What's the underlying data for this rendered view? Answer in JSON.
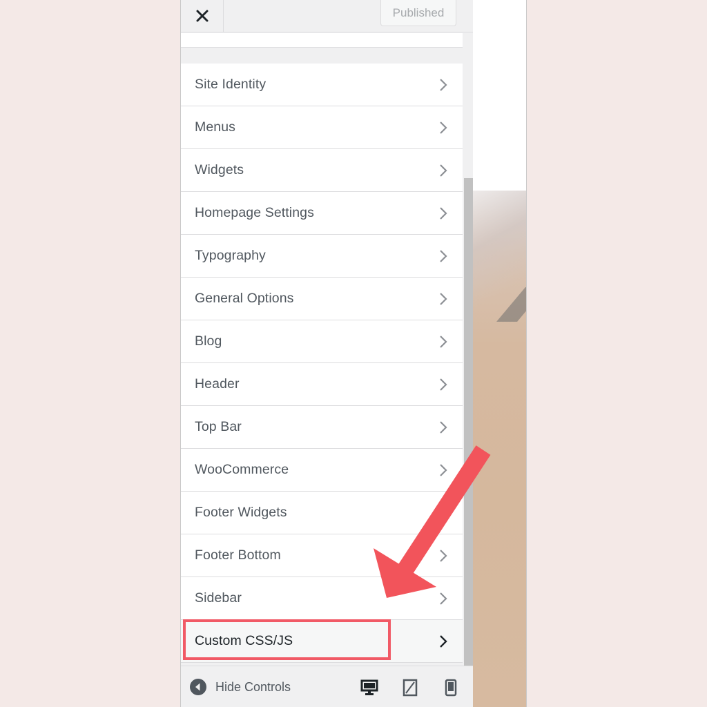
{
  "header": {
    "close_label": "Close",
    "publish_label": "Published"
  },
  "menu": {
    "items": [
      {
        "label": "Site Identity"
      },
      {
        "label": "Menus"
      },
      {
        "label": "Widgets"
      },
      {
        "label": "Homepage Settings"
      },
      {
        "label": "Typography"
      },
      {
        "label": "General Options"
      },
      {
        "label": "Blog"
      },
      {
        "label": "Header"
      },
      {
        "label": "Top Bar"
      },
      {
        "label": "WooCommerce"
      },
      {
        "label": "Footer Widgets"
      },
      {
        "label": "Footer Bottom"
      },
      {
        "label": "Sidebar"
      },
      {
        "label": "Custom CSS/JS"
      }
    ]
  },
  "footer": {
    "hide_controls_label": "Hide Controls",
    "devices": [
      "desktop-icon",
      "tablet-icon",
      "mobile-icon"
    ]
  },
  "annotation": {
    "highlight_color": "#f15a66",
    "arrow_color": "#f2545b"
  }
}
